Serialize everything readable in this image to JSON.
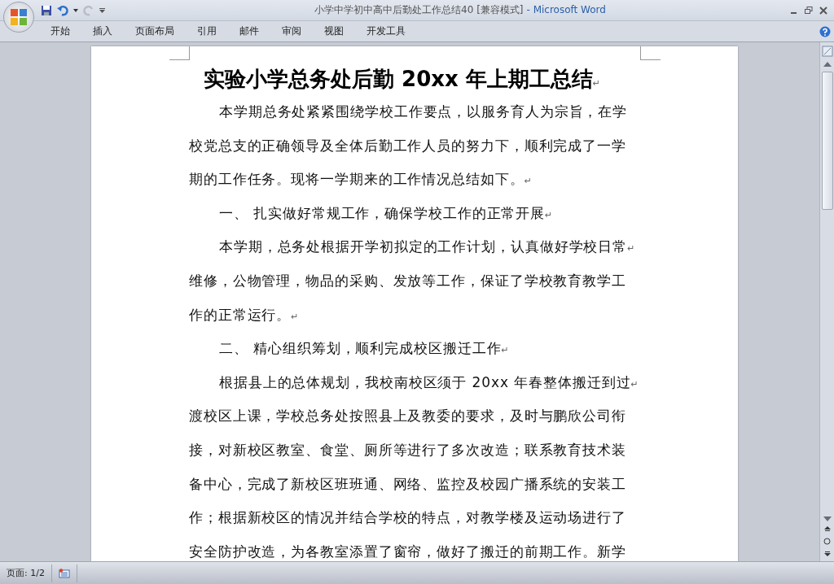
{
  "window": {
    "title": "小学中学初中高中后勤处工作总结40 [兼容模式]",
    "app": "- Microsoft Word"
  },
  "tabs": [
    {
      "label": "开始",
      "selected": false
    },
    {
      "label": "插入",
      "selected": false
    },
    {
      "label": "页面布局",
      "selected": false
    },
    {
      "label": "引用",
      "selected": false
    },
    {
      "label": "邮件",
      "selected": false
    },
    {
      "label": "审阅",
      "selected": false
    },
    {
      "label": "视图",
      "selected": false
    },
    {
      "label": "开发工具",
      "selected": false
    }
  ],
  "document": {
    "title": "实验小学总务处后勤 20xx 年上期工总结",
    "title_mark": "↵",
    "paragraphs": [
      {
        "lines": [
          {
            "text": "本学期总务处紧紧围绕学校工作要点，以服务育人为宗旨，在学"
          },
          {
            "text": "校党总支的正确领导及全体后勤工作人员的努力下，顺利完成了一学"
          },
          {
            "text": "期的工作任务。现将一学期来的工作情况总结如下。",
            "mark": "↵"
          }
        ]
      },
      {
        "lines": [
          {
            "text": "一、  扎实做好常规工作，确保学校工作的正常开展",
            "mark": "↵"
          }
        ]
      },
      {
        "lines": [
          {
            "text": "本学期，总务处根据开学初拟定的工作计划，认真做好学校日常",
            "mark": "↵"
          },
          {
            "text": "维修，公物管理，物品的采购、发放等工作，保证了学校教育教学工"
          },
          {
            "text": "作的正常运行。",
            "mark": "↵"
          }
        ]
      },
      {
        "lines": [
          {
            "text": "二、  精心组织筹划，顺利完成校区搬迁工作",
            "mark": "↵"
          }
        ]
      },
      {
        "lines": [
          {
            "text": "根据县上的总体规划，我校南校区须于 20xx 年春整体搬迁到过",
            "mark": "↵"
          },
          {
            "text": "渡校区上课，学校总务处按照县上及教委的要求，及时与鹏欣公司衔"
          },
          {
            "text": "接，对新校区教室、食堂、厕所等进行了多次改造；联系教育技术装"
          },
          {
            "text": "备中心，完成了新校区班班通、网络、监控及校园广播系统的安装工"
          },
          {
            "text": "作；根据新校区的情况并结合学校的特点，对教学楼及运动场进行了"
          },
          {
            "text": "安全防护改造，为各教室添置了窗帘，做好了搬迁的前期工作。新学"
          }
        ]
      }
    ]
  },
  "status_bar": {
    "page": "页面: 1/2"
  }
}
